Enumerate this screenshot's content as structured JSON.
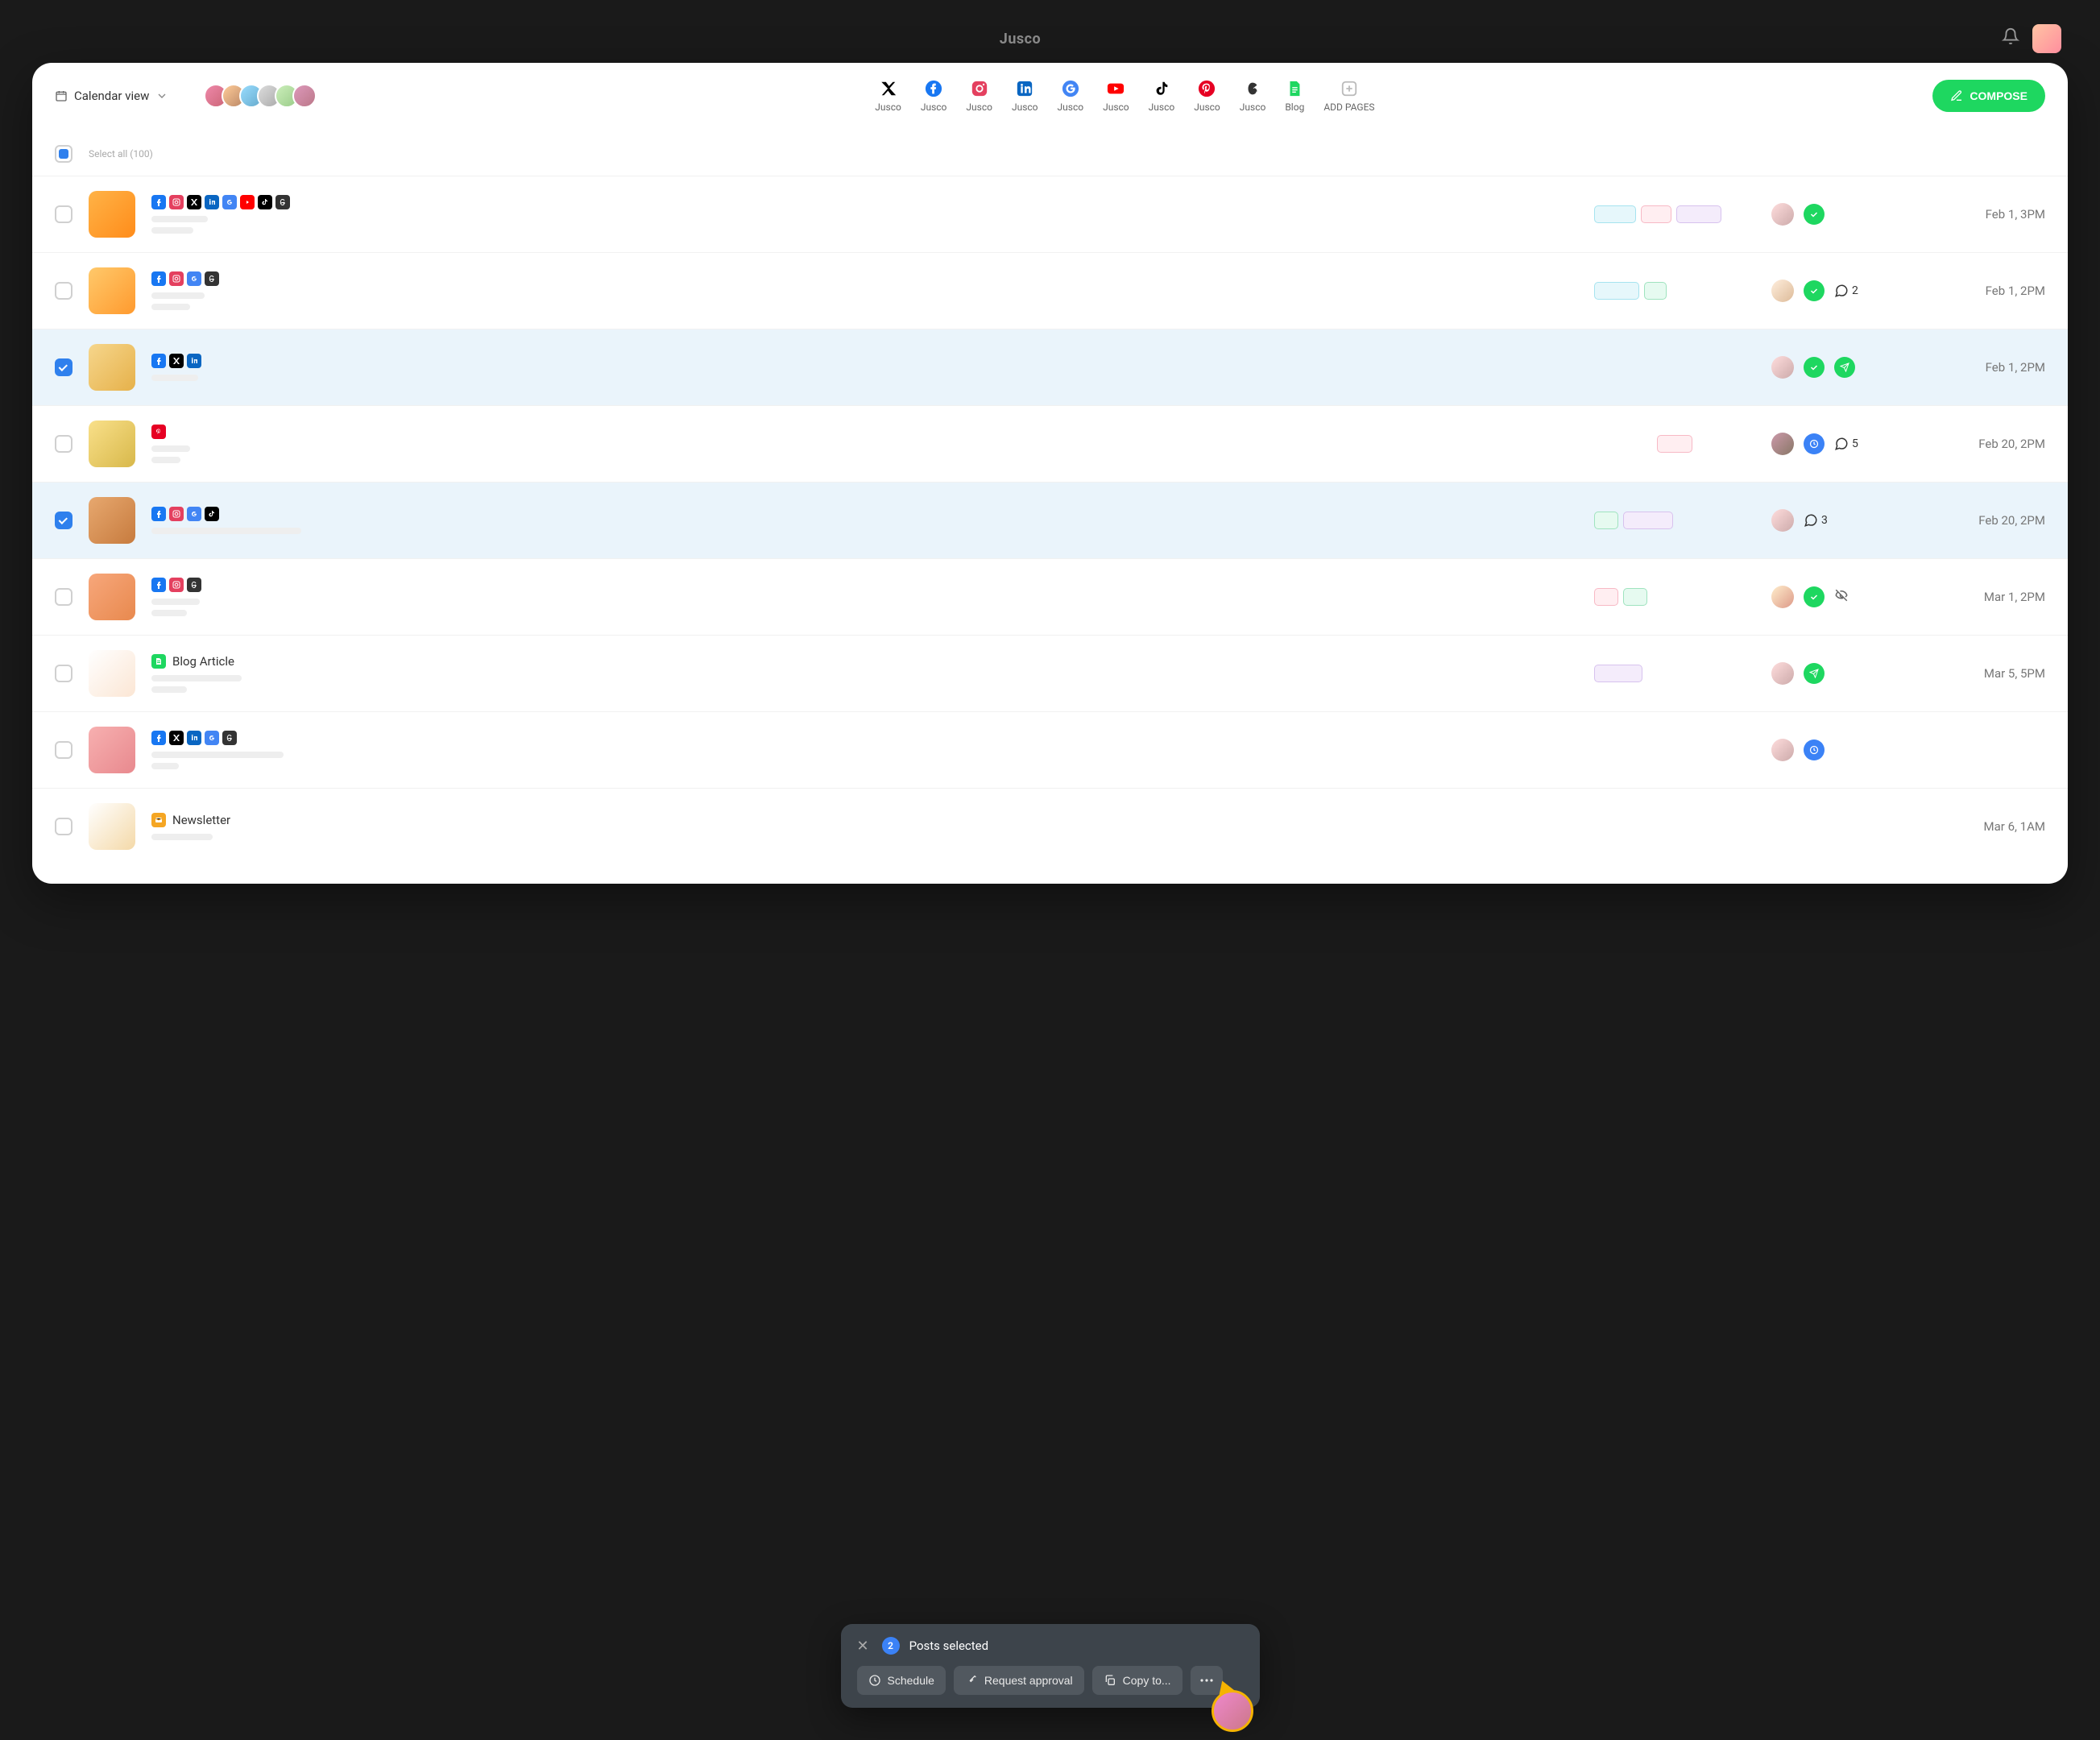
{
  "brand": "Jusco",
  "header": {
    "view_label": "Calendar view",
    "compose_label": "COMPOSE",
    "channels": [
      {
        "label": "Jusco",
        "type": "x"
      },
      {
        "label": "Jusco",
        "type": "facebook"
      },
      {
        "label": "Jusco",
        "type": "instagram"
      },
      {
        "label": "Jusco",
        "type": "linkedin"
      },
      {
        "label": "Jusco",
        "type": "gbusiness"
      },
      {
        "label": "Jusco",
        "type": "youtube"
      },
      {
        "label": "Jusco",
        "type": "tiktok"
      },
      {
        "label": "Jusco",
        "type": "pinterest"
      },
      {
        "label": "Jusco",
        "type": "threads"
      },
      {
        "label": "Blog",
        "type": "blog"
      },
      {
        "label": "ADD PAGES",
        "type": "add"
      }
    ]
  },
  "select_all": {
    "label": "Select all (100)"
  },
  "rows": [
    {
      "selected": false,
      "thumb_css": "linear-gradient(135deg,#ffb347,#ff8c1a)",
      "networks": [
        "fb",
        "ig",
        "x",
        "li",
        "gb",
        "yt",
        "tk",
        "th"
      ],
      "skeleton_widths": [
        70,
        52
      ],
      "labels": [
        {
          "w": 52,
          "bg": "#e6f7fb",
          "bd": "#a6e3ef"
        },
        {
          "w": 38,
          "bg": "#ffeef1",
          "bd": "#f7b9c5"
        },
        {
          "w": 56,
          "bg": "#f4ecfb",
          "bd": "#d7c2ee"
        }
      ],
      "assignee_css": "linear-gradient(135deg,#fdd,#caa)",
      "status": [
        "approved"
      ],
      "comments": null,
      "date": "Feb 1, 3PM"
    },
    {
      "selected": false,
      "thumb_css": "linear-gradient(135deg,#ffc96b,#ff9a2e)",
      "networks": [
        "fb",
        "ig",
        "gb",
        "th"
      ],
      "skeleton_widths": [
        66,
        48
      ],
      "labels": [
        {
          "w": 56,
          "bg": "#e6f7fb",
          "bd": "#a6e3ef"
        },
        {
          "w": 28,
          "bg": "#e6faf0",
          "bd": "#9fe3bf"
        }
      ],
      "assignee_css": "linear-gradient(135deg,#fed,#db9)",
      "status": [
        "approved"
      ],
      "comments": 2,
      "date": "Feb 1, 2PM"
    },
    {
      "selected": true,
      "thumb_css": "linear-gradient(135deg,#f6d68c,#e6b14a)",
      "networks": [
        "fb",
        "x",
        "li"
      ],
      "skeleton_widths": [
        58
      ],
      "labels": [],
      "assignee_css": "linear-gradient(135deg,#fdd,#caa)",
      "status": [
        "approved",
        "sent"
      ],
      "comments": null,
      "date": "Feb 1, 2PM"
    },
    {
      "selected": false,
      "thumb_css": "linear-gradient(135deg,#f9e08a,#d8b84a)",
      "networks": [
        "pt"
      ],
      "skeleton_widths": [
        48,
        36
      ],
      "labels": [
        {
          "w": 44,
          "bg": "#ffeef1",
          "bd": "#f7b9c5"
        }
      ],
      "labels_offset": true,
      "assignee_css": "linear-gradient(135deg,#c9a,#876)",
      "status": [
        "scheduled"
      ],
      "comments": 5,
      "date": "Feb 20, 2PM"
    },
    {
      "selected": true,
      "thumb_css": "linear-gradient(135deg,#e7a86f,#c77b3e)",
      "networks": [
        "fb",
        "ig",
        "gb",
        "tk"
      ],
      "skeleton_widths": [
        186
      ],
      "labels": [
        {
          "w": 30,
          "bg": "#e6faf0",
          "bd": "#9fe3bf"
        },
        {
          "w": 62,
          "bg": "#f4ecfb",
          "bd": "#d7c2ee"
        }
      ],
      "assignee_css": "linear-gradient(135deg,#fdd,#caa)",
      "status": [],
      "comments": 3,
      "date": "Feb 20, 2PM"
    },
    {
      "selected": false,
      "thumb_css": "linear-gradient(135deg,#f7a77b,#e8894e)",
      "networks": [
        "fb",
        "ig",
        "th"
      ],
      "skeleton_widths": [
        60,
        44
      ],
      "labels": [
        {
          "w": 30,
          "bg": "#ffeef1",
          "bd": "#f7b9c5"
        },
        {
          "w": 30,
          "bg": "#e6faf0",
          "bd": "#9fe3bf"
        }
      ],
      "assignee_css": "linear-gradient(135deg,#fec,#d98)",
      "status": [
        "approved"
      ],
      "hidden": true,
      "comments": null,
      "date": "Mar 1, 2PM"
    },
    {
      "selected": false,
      "thumb_css": "linear-gradient(135deg,#fff,#fbe6d4)",
      "title": "Blog Article",
      "title_icon": "blog",
      "skeleton_widths": [
        112,
        44
      ],
      "labels": [
        {
          "w": 60,
          "bg": "#f4ecfb",
          "bd": "#d7c2ee"
        }
      ],
      "assignee_css": "linear-gradient(135deg,#fdd,#caa)",
      "status": [
        "sent"
      ],
      "comments": null,
      "date": "Mar 5, 5PM"
    },
    {
      "selected": false,
      "thumb_css": "linear-gradient(135deg,#f7b0b0,#e8898e)",
      "networks": [
        "fb",
        "x",
        "li",
        "gb",
        "th"
      ],
      "skeleton_widths": [
        164,
        34
      ],
      "labels": [],
      "assignee_css": "linear-gradient(135deg,#fdd,#caa)",
      "status": [
        "scheduled"
      ],
      "comments": null,
      "date": ""
    },
    {
      "selected": false,
      "thumb_css": "linear-gradient(135deg,#fff,#f4d9a8)",
      "title": "Newsletter",
      "title_icon": "newsletter",
      "skeleton_widths": [
        76
      ],
      "labels": [],
      "assignee_css": "",
      "status": [],
      "comments": null,
      "date": "Mar 6, 1AM"
    }
  ],
  "actionbar": {
    "count": "2",
    "text": "Posts selected",
    "schedule": "Schedule",
    "request_approval": "Request approval",
    "copy_to": "Copy to..."
  }
}
